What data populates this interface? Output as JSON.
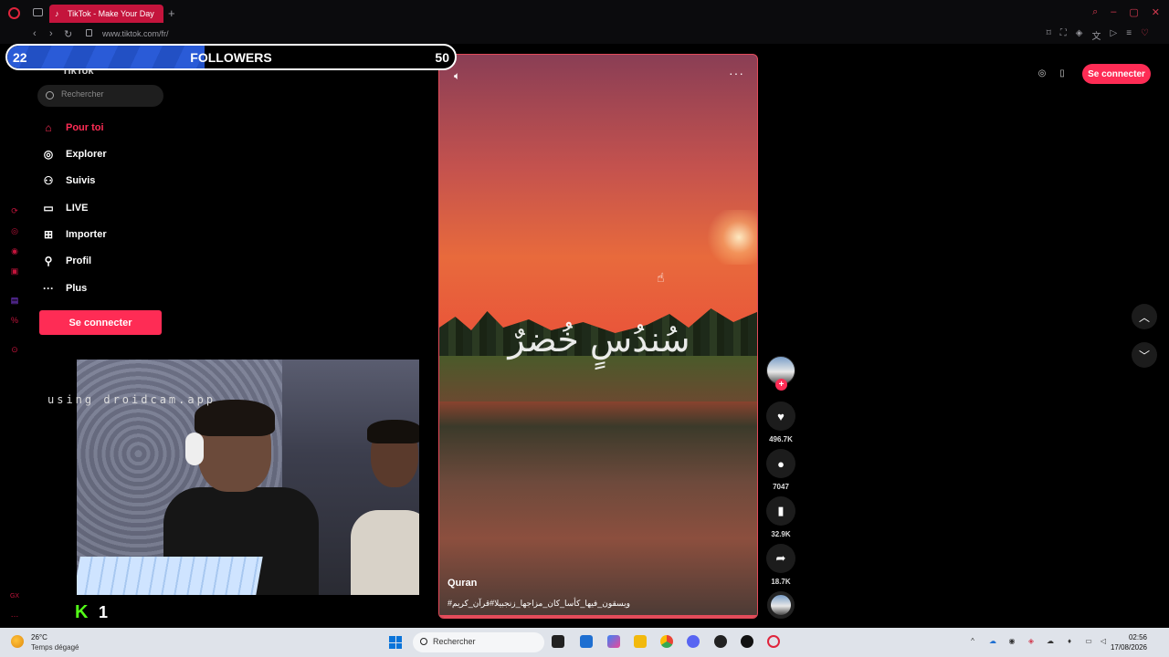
{
  "browser": {
    "tab_title": "TikTok - Make Your Day",
    "new_tab": "+",
    "url": "www.tiktok.com/fr/"
  },
  "overlay": {
    "followers_count": "22",
    "followers_label": "FOLLOWERS",
    "followers_goal": "50",
    "followers_progress": 0.44,
    "droidcam_text": "using droidcam.app",
    "kick_count": "1"
  },
  "sidebar": {
    "logo": "TikTok",
    "search_placeholder": "Rechercher",
    "items": [
      {
        "label": "Pour toi",
        "icon": "home-icon",
        "active": true
      },
      {
        "label": "Explorer",
        "icon": "compass-icon"
      },
      {
        "label": "Suivis",
        "icon": "following-icon"
      },
      {
        "label": "LIVE",
        "icon": "live-icon"
      },
      {
        "label": "Importer",
        "icon": "upload-icon"
      },
      {
        "label": "Profil",
        "icon": "profile-icon"
      },
      {
        "label": "Plus",
        "icon": "more-icon"
      }
    ],
    "login_label": "Se connecter"
  },
  "header": {
    "login_label": "Se connecter"
  },
  "video": {
    "overlay_text": "سُندُسٍ خُضرٌ",
    "author": "Quran",
    "description": "#ويسقون_فيها_كأسا_كان_مزاجها_زنجبيلا#قرآن_كريم"
  },
  "actions": {
    "likes": "496.7K",
    "comments": "7047",
    "saves": "32.9K",
    "shares": "18.7K"
  },
  "taskbar": {
    "temperature": "26°C",
    "weather": "Temps dégagé",
    "search_label": "Rechercher",
    "time": "02:56",
    "date": "17/08/2026"
  },
  "colors": {
    "accent": "#fe2c55",
    "browser_accent": "#c4143c",
    "followers_bar": "#2a5bd7"
  }
}
